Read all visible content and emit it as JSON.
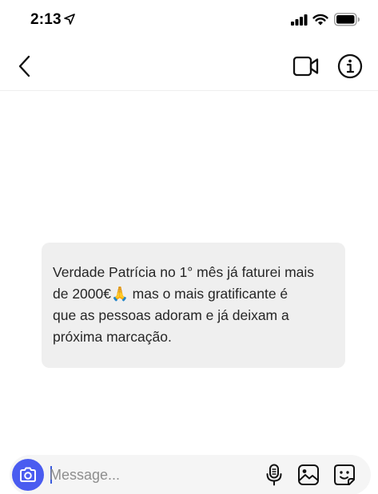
{
  "status_bar": {
    "time": "2:13",
    "icons": [
      "location-arrow-icon",
      "cellular-signal-icon",
      "wifi-icon",
      "battery-icon"
    ]
  },
  "header": {
    "icons": [
      "back-chevron-icon",
      "video-call-icon",
      "info-icon"
    ]
  },
  "thread": {
    "messages": [
      {
        "text": "Verdade Patrícia  no 1° mês já faturei mais\nde 2000€🙏 mas o mais gratificante é\nque as pessoas adoram e já deixam a\npróxima marcação."
      }
    ]
  },
  "composer": {
    "placeholder": "Message...",
    "value": "",
    "icons": [
      "camera-icon",
      "microphone-icon",
      "gallery-icon",
      "sticker-icon"
    ],
    "accent_color": "#4a5cf0"
  }
}
